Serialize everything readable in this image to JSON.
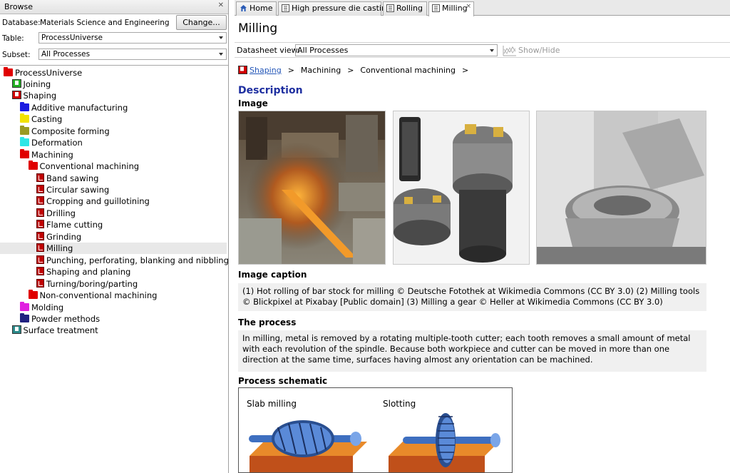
{
  "left": {
    "title": "Browse",
    "database_label": "Database:",
    "database_value": "Materials Science and Engineering",
    "change_button": "Change...",
    "table_label": "Table:",
    "table_value": "ProcessUniverse",
    "subset_label": "Subset:",
    "subset_value": "All Processes"
  },
  "tree": [
    {
      "label": "ProcessUniverse",
      "icon": "red-folder-icon",
      "color": "#e00000",
      "depth": 0
    },
    {
      "label": "Joining",
      "icon": "green-book-icon",
      "color": "#22b022",
      "depth": 1
    },
    {
      "label": "Shaping",
      "icon": "red-book-icon",
      "color": "#d00000",
      "depth": 1
    },
    {
      "label": "Additive manufacturing",
      "icon": "blue-folder-icon",
      "color": "#1a1ae0",
      "depth": 2
    },
    {
      "label": "Casting",
      "icon": "yellow-folder-icon",
      "color": "#f2e200",
      "depth": 2
    },
    {
      "label": "Composite forming",
      "icon": "olive-folder-icon",
      "color": "#9a9a22",
      "depth": 2
    },
    {
      "label": "Deformation",
      "icon": "cyan-folder-icon",
      "color": "#2ee6e6",
      "depth": 2
    },
    {
      "label": "Machining",
      "icon": "red-folder-icon",
      "color": "#e00000",
      "depth": 2
    },
    {
      "label": "Conventional machining",
      "icon": "red-folder-icon",
      "color": "#e00000",
      "depth": 3
    },
    {
      "label": "Band sawing",
      "icon": "datasheet-icon",
      "depth": 4
    },
    {
      "label": "Circular sawing",
      "icon": "datasheet-icon",
      "depth": 4
    },
    {
      "label": "Cropping and guillotining",
      "icon": "datasheet-icon",
      "depth": 4
    },
    {
      "label": "Drilling",
      "icon": "datasheet-icon",
      "depth": 4
    },
    {
      "label": "Flame cutting",
      "icon": "datasheet-icon",
      "depth": 4
    },
    {
      "label": "Grinding",
      "icon": "datasheet-icon",
      "depth": 4
    },
    {
      "label": "Milling",
      "icon": "datasheet-icon",
      "depth": 4,
      "selected": true
    },
    {
      "label": "Punching, perforating, blanking and nibbling",
      "icon": "datasheet-icon",
      "depth": 4
    },
    {
      "label": "Shaping and planing",
      "icon": "datasheet-icon",
      "depth": 4
    },
    {
      "label": "Turning/boring/parting",
      "icon": "datasheet-icon",
      "depth": 4
    },
    {
      "label": "Non-conventional machining",
      "icon": "red-folder-icon",
      "color": "#e00000",
      "depth": 3
    },
    {
      "label": "Molding",
      "icon": "magenta-folder-icon",
      "color": "#e020e0",
      "depth": 2
    },
    {
      "label": "Powder methods",
      "icon": "navy-folder-icon",
      "color": "#202080",
      "depth": 2
    },
    {
      "label": "Surface treatment",
      "icon": "teal-book-icon",
      "color": "#2a8a8a",
      "depth": 1
    }
  ],
  "tabs": [
    {
      "label": "Home",
      "icon": "home-icon"
    },
    {
      "label": "High pressure die casting",
      "icon": "datasheet-icon"
    },
    {
      "label": "Rolling",
      "icon": "datasheet-icon"
    },
    {
      "label": "Milling",
      "icon": "datasheet-icon",
      "active": true
    }
  ],
  "page": {
    "title": "Milling",
    "datasheet_label": "Datasheet view:",
    "datasheet_value": "All Processes",
    "show_hide": "Show/Hide",
    "breadcrumb": [
      "Shaping",
      "Machining",
      "Conventional machining"
    ],
    "breadcrumb_sep": ">",
    "description_heading": "Description",
    "image_heading": "Image",
    "caption_heading": "Image caption",
    "caption_text": "(1) Hot rolling of bar stock for milling © Deutsche Fotothek at Wikimedia Commons (CC BY 3.0) (2) Milling tools © Blickpixel at Pixabay [Public domain] (3) Milling a gear © Heller at Wikimedia Commons (CC BY 3.0)",
    "process_heading": "The process",
    "process_text": "In milling, metal is removed by a rotating multiple-tooth cutter; each tooth removes a small amount of metal with each revolution of the spindle. Because both workpiece and cutter can be moved in more than one direction at the same time, surfaces having almost any orientation can be machined.",
    "schematic_heading": "Process schematic",
    "schematic_labels": [
      "Slab milling",
      "Slotting"
    ]
  },
  "colors": {
    "accent": "#1e2fa0",
    "link": "#2356b8",
    "selection": "#e8e8e8"
  }
}
